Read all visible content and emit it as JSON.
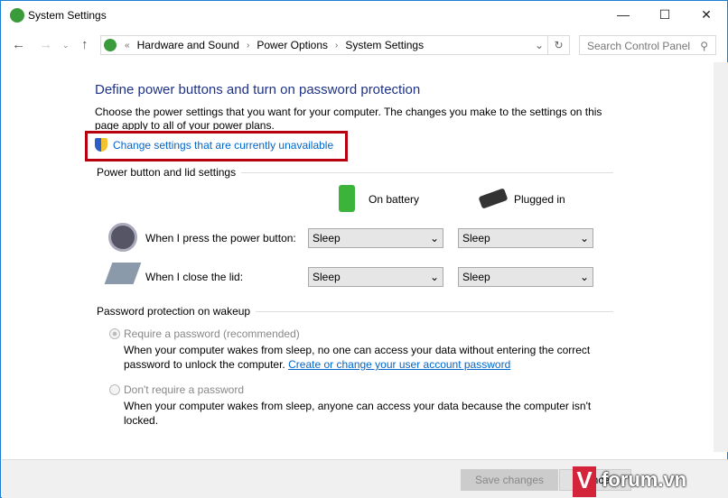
{
  "window": {
    "title": "System Settings"
  },
  "breadcrumb": [
    "Hardware and Sound",
    "Power Options",
    "System Settings"
  ],
  "search": {
    "placeholder": "Search Control Panel"
  },
  "heading": "Define power buttons and turn on password protection",
  "description": "Choose the power settings that you want for your computer. The changes you make to the settings on this page apply to all of your power plans.",
  "change_link": "Change settings that are currently unavailable",
  "power_section": {
    "title": "Power button and lid settings",
    "on_battery": "On battery",
    "plugged_in": "Plugged in",
    "rows": [
      {
        "label": "When I press the power button:",
        "battery": "Sleep",
        "plugged": "Sleep"
      },
      {
        "label": "When I close the lid:",
        "battery": "Sleep",
        "plugged": "Sleep"
      }
    ]
  },
  "password_section": {
    "title": "Password protection on wakeup",
    "opt1": {
      "label": "Require a password (recommended)",
      "desc": "When your computer wakes from sleep, no one can access your data without entering the correct password to unlock the computer.",
      "link": "Create or change your user account password"
    },
    "opt2": {
      "label": "Don't require a password",
      "desc": "When your computer wakes from sleep, anyone can access your data because the computer isn't locked."
    }
  },
  "footer": {
    "save": "Save changes",
    "cancel": "Cancel"
  },
  "watermark": "Vforum.vn"
}
